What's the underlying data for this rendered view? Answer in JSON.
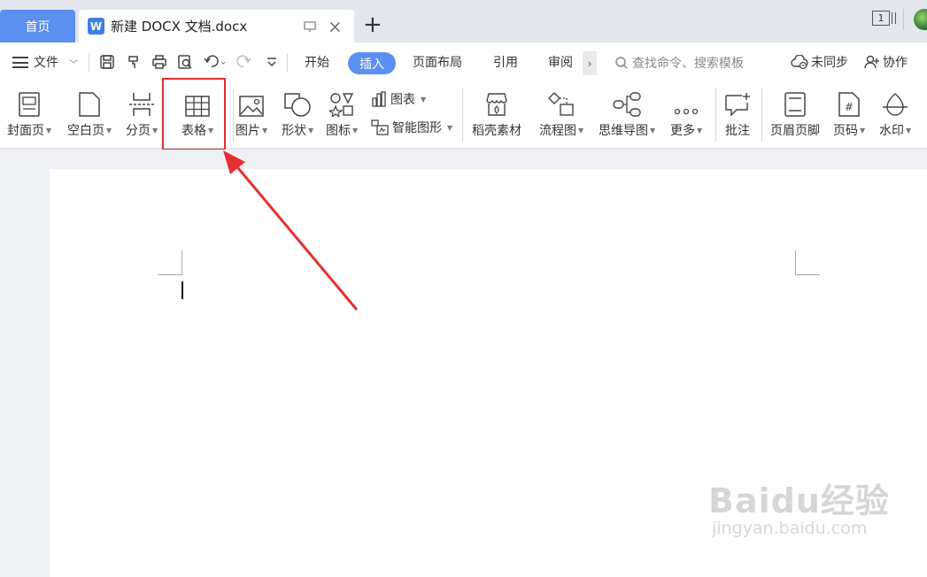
{
  "tabs": {
    "home": "首页",
    "doc_icon": "W",
    "doc_title": "新建 DOCX 文档.docx",
    "new_tab": "+",
    "window_count": "1"
  },
  "menu": {
    "file": "文件",
    "tabs": [
      "开始",
      "插入",
      "页面布局",
      "引用",
      "审阅"
    ],
    "active_tab": "插入",
    "search_placeholder": "查找命令、搜索模板",
    "sync": "未同步",
    "collab": "协作"
  },
  "ribbon": {
    "cover": "封面页",
    "blank": "空白页",
    "pagebreak": "分页",
    "table": "表格",
    "picture": "图片",
    "shape": "形状",
    "icon": "图标",
    "chart": "图表",
    "smartart": "智能图形",
    "docer": "稻壳素材",
    "flowchart": "流程图",
    "mindmap": "思维导图",
    "more": "更多",
    "comment": "批注",
    "headerfooter": "页眉页脚",
    "pagenum": "页码",
    "watermark": "水印"
  },
  "annotation": {
    "highlight_color": "#e03030",
    "highlight_target": "表格"
  },
  "watermark_text": {
    "title": "Baidu经验",
    "url": "jingyan.baidu.com"
  },
  "colors": {
    "accent": "#5b8ff0",
    "titlebar": "#e3e6ec"
  }
}
